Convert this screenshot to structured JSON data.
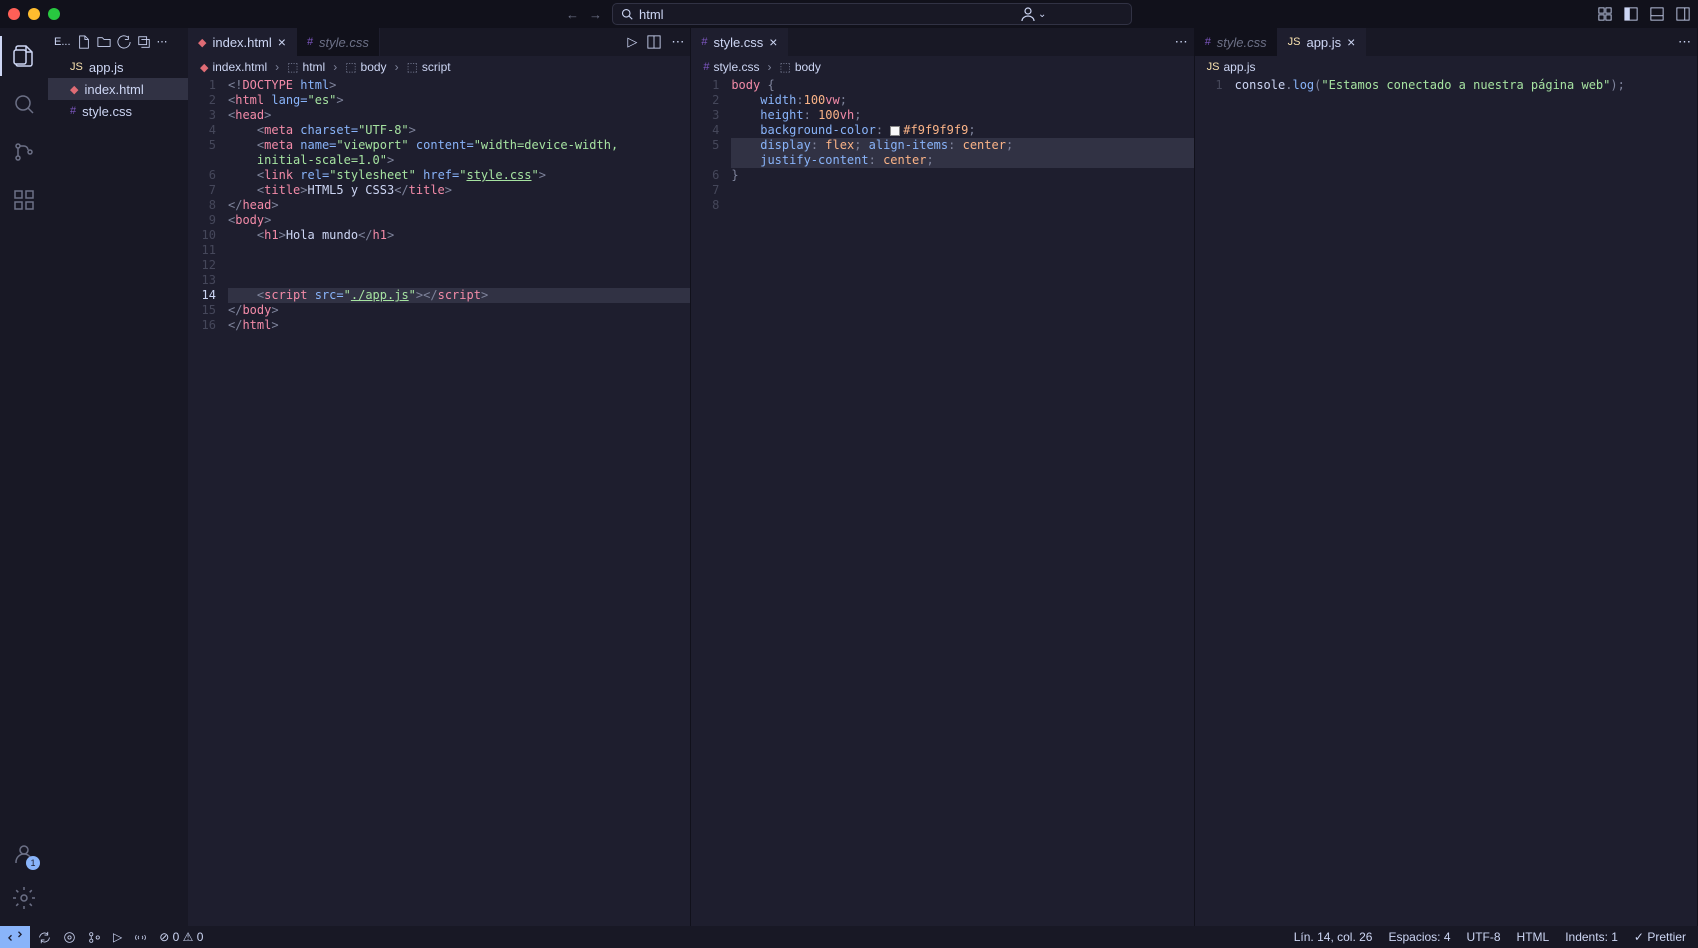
{
  "titlebar": {
    "search_text": "html"
  },
  "sidebar": {
    "header": "E...",
    "files": [
      {
        "name": "app.js",
        "type": "js"
      },
      {
        "name": "index.html",
        "type": "html"
      },
      {
        "name": "style.css",
        "type": "css"
      }
    ]
  },
  "editor_groups": [
    {
      "tabs": [
        {
          "label": "index.html",
          "icon": "html",
          "active": true,
          "closable": true
        },
        {
          "label": "style.css",
          "icon": "css",
          "active": false,
          "closable": false,
          "italic": true
        }
      ],
      "breadcrumb": [
        "index.html",
        "html",
        "body",
        "script"
      ],
      "code_type": "html",
      "cursor_line": 14,
      "lines": 16
    },
    {
      "tabs": [
        {
          "label": "style.css",
          "icon": "css",
          "active": true,
          "closable": true
        }
      ],
      "breadcrumb": [
        "style.css",
        "body"
      ],
      "code_type": "css",
      "lines": 8
    },
    {
      "tabs": [
        {
          "label": "style.css",
          "icon": "css",
          "active": false,
          "closable": false,
          "italic": true
        },
        {
          "label": "app.js",
          "icon": "js",
          "active": true,
          "closable": true
        }
      ],
      "breadcrumb": [
        "app.js"
      ],
      "code_type": "js",
      "lines": 1
    }
  ],
  "code_html": {
    "l1": {
      "doctype": "DOCTYPE",
      "html": "html"
    },
    "l2": {
      "lang_attr": "lang=",
      "lang_val": "\"es\""
    },
    "l3": "head",
    "l4": {
      "attr1": "charset=",
      "val1": "\"UTF-8\""
    },
    "l5": {
      "attr1": "name=",
      "val1": "\"viewport\"",
      "attr2": "content=",
      "val2": "\"width=device-width, initial-scale=1.0\""
    },
    "l6": {
      "attr1": "rel=",
      "val1": "\"stylesheet\"",
      "attr2": "href=",
      "val2": "style.css"
    },
    "l7": {
      "text": "HTML5 y CSS3"
    },
    "l8": "head",
    "l9": "body",
    "l10": {
      "text": "Hola mundo"
    },
    "l14": {
      "attr": "src=",
      "val": "./app.js"
    },
    "l15": "body",
    "l16": "html"
  },
  "code_css": {
    "selector": "body",
    "props": {
      "width": {
        "name": "width",
        "val": "100",
        "unit": "vw"
      },
      "height": {
        "name": "height",
        "val": "100",
        "unit": "vh"
      },
      "bg": {
        "name": "background-color",
        "val": "#f9f9f9f9"
      },
      "display": {
        "name": "display",
        "val": "flex"
      },
      "align": {
        "name": "align-items",
        "val": "center"
      },
      "justify": {
        "name": "justify-content",
        "val": "center"
      }
    }
  },
  "code_js": {
    "obj": "console",
    "method": "log",
    "str": "\"Estamos conectado a nuestra página web\""
  },
  "statusbar": {
    "errors": "0",
    "warnings": "0",
    "position": "Lín. 14, col. 26",
    "spaces": "Espacios: 4",
    "encoding": "UTF-8",
    "language": "HTML",
    "indents": "Indents: 1",
    "prettier": "Prettier"
  },
  "accounts_badge": "1"
}
